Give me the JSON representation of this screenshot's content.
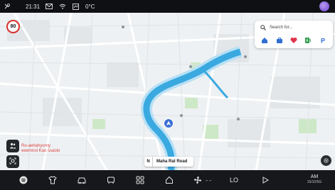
{
  "status_bar": {
    "time": "21:31",
    "temperature": "0°C",
    "icons": [
      "climate-icon",
      "message-icon",
      "wifi-icon",
      "network-icon"
    ]
  },
  "map": {
    "speed_limit": "80",
    "current_street_direction": "N",
    "current_street": "Maha Rat Road",
    "note_text": "Ro-aehahyorny eeemnoi Kao ssaoio",
    "colors": {
      "river": "#3aa9e0",
      "water_edge": "#b8e0f5",
      "road": "#ffffff",
      "park": "#cde8c6"
    }
  },
  "search": {
    "placeholder": "Search for...",
    "quick_icons": [
      "home-icon",
      "work-icon",
      "favorite-icon",
      "ev-charging-icon",
      "parking-icon"
    ]
  },
  "dock": {
    "items": [
      "spotify-icon",
      "shirt-icon",
      "car-icon",
      "seat-icon",
      "apps-grid-icon",
      "home-icon",
      "fan-icon",
      "fan-level",
      "lo-label",
      "play-icon"
    ],
    "fan_level": "- -",
    "temp_label": "LO",
    "clock_ampm": "AM",
    "clock_date": "15/10/5G"
  }
}
